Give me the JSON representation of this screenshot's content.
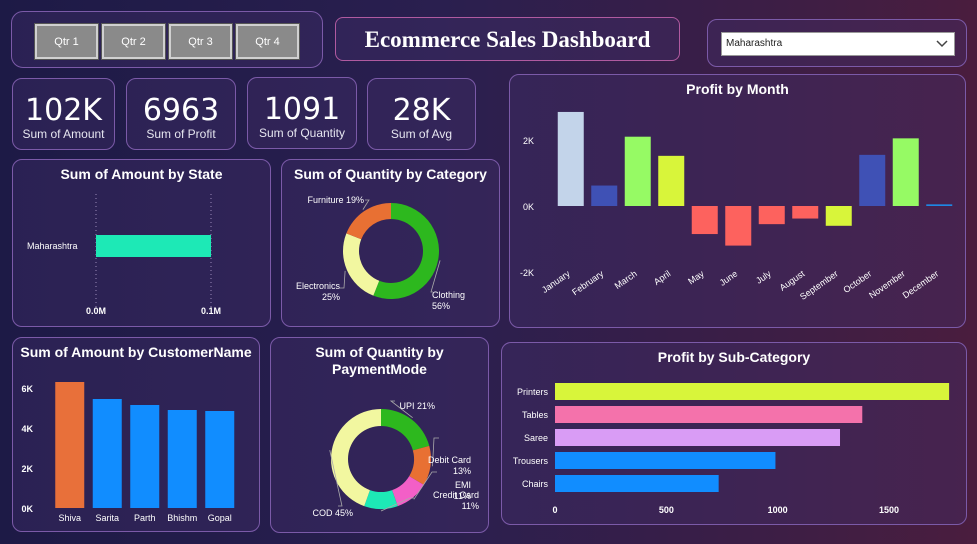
{
  "header": {
    "title": "Ecommerce Sales Dashboard"
  },
  "slicer": {
    "buttons": [
      "Qtr 1",
      "Qtr 2",
      "Qtr 3",
      "Qtr 4"
    ]
  },
  "dropdown": {
    "value": "Maharashtra"
  },
  "kpis": [
    {
      "value": "102K",
      "label": "Sum of Amount"
    },
    {
      "value": "6963",
      "label": "Sum of Profit"
    },
    {
      "value": "1091",
      "label": "Sum of Quantity"
    },
    {
      "value": "28K",
      "label": "Sum of Avg"
    }
  ],
  "colors": {
    "accent_border": "#7b5aa8"
  },
  "chart_data": [
    {
      "id": "state",
      "type": "bar",
      "orientation": "horizontal",
      "title": "Sum of Amount by State",
      "categories": [
        "Maharashtra"
      ],
      "values": [
        0.1
      ],
      "xlim": [
        0,
        0.1
      ],
      "xticks": [
        "0.0M",
        "0.1M"
      ],
      "colors": [
        "#1de9b6"
      ]
    },
    {
      "id": "category",
      "type": "pie",
      "donut": true,
      "title": "Sum of Quantity by Category",
      "labels": [
        "Clothing",
        "Electronics",
        "Furniture"
      ],
      "values": [
        56,
        25,
        19
      ],
      "display": [
        "Clothing\n56%",
        "Electronics\n25%",
        "Furniture 19%"
      ],
      "colors": [
        "#2db81e",
        "#f2f7a0",
        "#e87033"
      ]
    },
    {
      "id": "month",
      "type": "bar",
      "title": "Profit by Month",
      "categories": [
        "January",
        "February",
        "March",
        "April",
        "May",
        "June",
        "July",
        "August",
        "September",
        "October",
        "November",
        "December"
      ],
      "values": [
        2850,
        620,
        2100,
        1520,
        -850,
        -1200,
        -550,
        -380,
        -600,
        1550,
        2050,
        50
      ],
      "ylim": [
        -2000,
        3000
      ],
      "yticks": [
        {
          "v": 2000,
          "t": "2K"
        },
        {
          "v": 0,
          "t": "0K"
        },
        {
          "v": -2000,
          "t": "-2K"
        }
      ],
      "colors": [
        "#c3d4ea",
        "#3f51b5",
        "#96fa64",
        "#d8f53a",
        "#fd625e",
        "#fd625e",
        "#fd625e",
        "#fd625e",
        "#d8f53a",
        "#3f51b5",
        "#96fa64",
        "#1e88e5"
      ]
    },
    {
      "id": "customer",
      "type": "bar",
      "title": "Sum of Amount by CustomerName",
      "categories": [
        "Shiva",
        "Sarita",
        "Parth",
        "Bhishm",
        "Gopal"
      ],
      "values": [
        6300,
        5450,
        5150,
        4900,
        4850
      ],
      "ylim": [
        0,
        7000
      ],
      "yticks": [
        {
          "v": 6000,
          "t": "6K"
        },
        {
          "v": 4000,
          "t": "4K"
        },
        {
          "v": 2000,
          "t": "2K"
        },
        {
          "v": 0,
          "t": "0K"
        }
      ],
      "colors": [
        "#e8703a",
        "#118dff",
        "#118dff",
        "#118dff",
        "#118dff"
      ]
    },
    {
      "id": "payment",
      "type": "pie",
      "donut": true,
      "title": "Sum of Quantity by PaymentMode",
      "labels": [
        "UPI",
        "Debit Card",
        "EMI",
        "Credit Card",
        "COD"
      ],
      "values": [
        21,
        13,
        11,
        11,
        45
      ],
      "display": [
        "UPI 21%",
        "Debit Card\n13%",
        "EMI\n11%",
        "Credit Card\n11%",
        "COD 45%"
      ],
      "colors": [
        "#2db81e",
        "#e87033",
        "#f35fc7",
        "#1de9b6",
        "#f2f7a0"
      ]
    },
    {
      "id": "subcat",
      "type": "bar",
      "orientation": "horizontal",
      "title": "Profit by Sub-Category",
      "categories": [
        "Printers",
        "Tables",
        "Saree",
        "Trousers",
        "Chairs"
      ],
      "values": [
        1770,
        1380,
        1280,
        990,
        735
      ],
      "xlim": [
        0,
        1800
      ],
      "xticks": [
        {
          "v": 0,
          "t": "0"
        },
        {
          "v": 500,
          "t": "500"
        },
        {
          "v": 1000,
          "t": "1000"
        },
        {
          "v": 1500,
          "t": "1500"
        }
      ],
      "colors": [
        "#d8f53a",
        "#f472ab",
        "#d99cf5",
        "#118dff",
        "#118dff"
      ]
    }
  ]
}
